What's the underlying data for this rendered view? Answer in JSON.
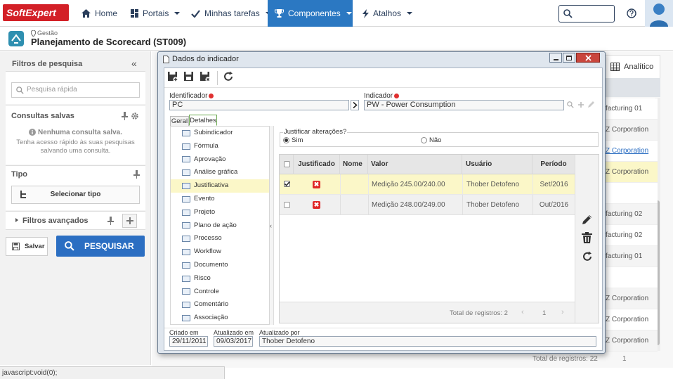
{
  "nav": {
    "logo": "SoftExpert",
    "home": "Home",
    "portais": "Portais",
    "tarefas": "Minhas tarefas",
    "componentes": "Componentes",
    "atalhos": "Atalhos"
  },
  "header": {
    "breadcrumb": "Gestão",
    "title": "Planejamento de Scorecard (ST009)"
  },
  "left": {
    "filters_title": "Filtros de pesquisa",
    "search_placeholder": "Pesquisa rápida",
    "saved_title": "Consultas salvas",
    "no_saved": "Nenhuma consulta salva.",
    "saved_hint": "Tenha acesso rápido às suas pesquisas salvando uma consulta.",
    "type_title": "Tipo",
    "select_type": "Selecionar tipo",
    "advanced": "Filtros avançados",
    "save": "Salvar",
    "search": "PESQUISAR"
  },
  "background": {
    "tab_analitico": "Analítico",
    "rows": [
      "facturing 01",
      "Z Corporation",
      "Z Corporation",
      "Z Corporation",
      "facturing 02",
      "facturing 02",
      "facturing 01",
      "Z Corporation",
      "Z Corporation",
      "Z Corporation"
    ],
    "total": "Total de registros: 22",
    "page": "1"
  },
  "status_bar": "javascript:void(0);",
  "dialog": {
    "title": "Dados do indicador",
    "identificador_label": "Identificador",
    "identificador_value": "PC",
    "indicador_label": "Indicador",
    "indicador_value": "PW - Power Consumption",
    "tabs": [
      "Geral",
      "Detalhes"
    ],
    "tree": [
      "Subindicador",
      "Fórmula",
      "Aprovação",
      "Análise gráfica",
      "Justificativa",
      "Evento",
      "Projeto",
      "Plano de ação",
      "Processo",
      "Workflow",
      "Documento",
      "Risco",
      "Controle",
      "Comentário",
      "Associação"
    ],
    "justify_label": "Justificar alterações?",
    "sim": "Sim",
    "nao": "Não",
    "columns": [
      "Justificado",
      "Nome",
      "Valor",
      "Usuário",
      "Período"
    ],
    "rows": [
      {
        "nome": "",
        "valor": "Medição 245.00/240.00",
        "usuario": "Thober Detofeno",
        "periodo": "Set/2016"
      },
      {
        "nome": "",
        "valor": "Medição 248.00/249.00",
        "usuario": "Thober Detofeno",
        "periodo": "Out/2016"
      }
    ],
    "total": "Total de registros: 2",
    "page": "1",
    "created_label": "Criado em",
    "created_value": "29/11/2011",
    "updated_label": "Atualizado em",
    "updated_value": "09/03/2017",
    "updated_by_label": "Atualizado por",
    "updated_by_value": "Thober Detofeno"
  }
}
